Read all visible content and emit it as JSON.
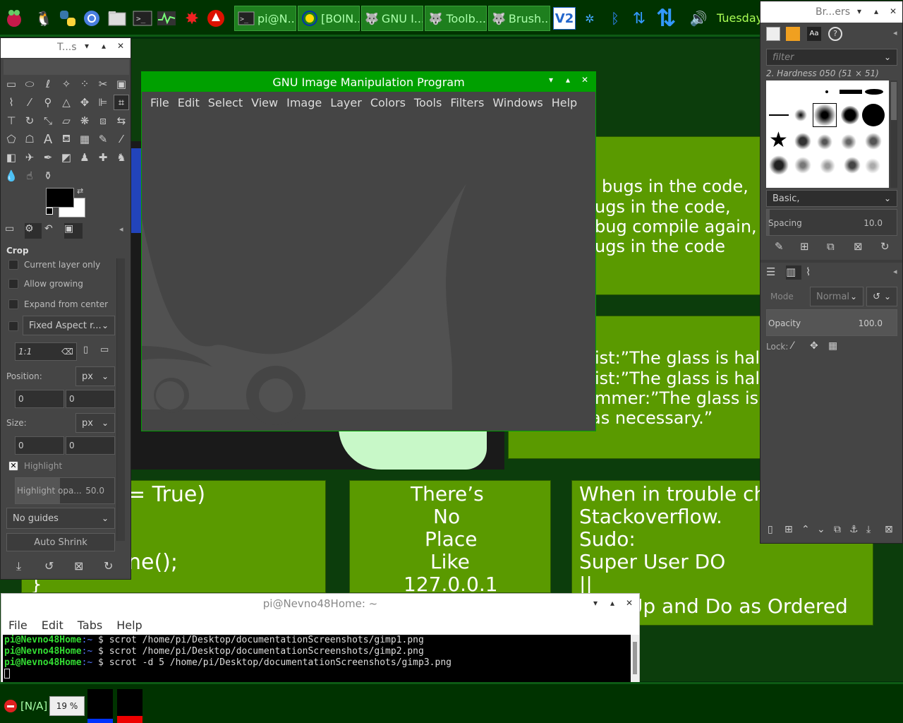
{
  "taskbar": {
    "tasks": [
      {
        "label": "pi@N...",
        "icon": "terminal-icon"
      },
      {
        "label": "[BOIN...",
        "icon": "boinc-icon"
      },
      {
        "label": "GNU I...",
        "icon": "gimp-icon"
      },
      {
        "label": "Toolb...",
        "icon": "gimp-icon"
      },
      {
        "label": "Brush...",
        "icon": "gimp-icon"
      }
    ],
    "clock": "Tuesday"
  },
  "wallpaper": {
    "slide1": [
      "bugs in the code,",
      "ugs in the code,",
      "bug compile again,",
      "ugs in the code"
    ],
    "slide2": [
      "ist:”The glass is hal",
      "ist:”The glass is half",
      "mmer:”The glass is",
      "as necessary.”"
    ],
    "slide3_code": [
      "= True)",
      "ne();",
      "}"
    ],
    "slide4": [
      "There’s",
      "No",
      "Place",
      "Like",
      "127.0.0.1"
    ],
    "slide5": [
      "When in trouble ch",
      "Stackoverflow.",
      "Sudo:",
      "Super User DO",
      "||",
      "t Up and Do as Ordered"
    ]
  },
  "toolbox": {
    "title": "T...s",
    "tool_options_title": "Crop",
    "options": {
      "current_layer_only": "Current layer only",
      "allow_growing": "Allow growing",
      "expand_from_center": "Expand from center",
      "fixed_aspect": "Fixed Aspect r...",
      "aspect_value": "1:1",
      "position_label": "Position:",
      "position_unit": "px",
      "pos_x": "0",
      "pos_y": "0",
      "size_label": "Size:",
      "size_unit": "px",
      "size_w": "0",
      "size_h": "0",
      "highlight": "Highlight",
      "highlight_opacity_label": "Highlight opa...",
      "highlight_opacity_value": "50.0",
      "guides": "No guides",
      "auto_shrink": "Auto Shrink"
    }
  },
  "gimp": {
    "title": "GNU Image Manipulation Program",
    "menu": [
      "File",
      "Edit",
      "Select",
      "View",
      "Image",
      "Layer",
      "Colors",
      "Tools",
      "Filters",
      "Windows",
      "Help"
    ]
  },
  "brushes": {
    "title": "Br...ers",
    "filter_placeholder": "filter",
    "selected_brush": "2. Hardness 050 (51 × 51)",
    "preset": "Basic,",
    "spacing_label": "Spacing",
    "spacing_value": "10.0",
    "mode_label": "Mode",
    "mode_value": "Normal",
    "opacity_label": "Opacity",
    "opacity_value": "100.0",
    "lock_label": "Lock:"
  },
  "terminal": {
    "title": "pi@Nevno48Home: ~",
    "menu": [
      "File",
      "Edit",
      "Tabs",
      "Help"
    ],
    "lines": [
      {
        "user": "pi@Nevno48Home",
        "path": ":~",
        "cmd": " $ scrot /home/pi/Desktop/documentationScreenshots/gimp1.png"
      },
      {
        "user": "pi@Nevno48Home",
        "path": ":~",
        "cmd": " $ scrot /home/pi/Desktop/documentationScreenshots/gimp2.png"
      },
      {
        "user": "pi@Nevno48Home",
        "path": ":~",
        "cmd": " $ scrot -d 5 /home/pi/Desktop/documentationScreenshots/gimp3.png"
      }
    ]
  },
  "bottom_panel": {
    "status": "[N/A]",
    "cpu": "19 %"
  }
}
